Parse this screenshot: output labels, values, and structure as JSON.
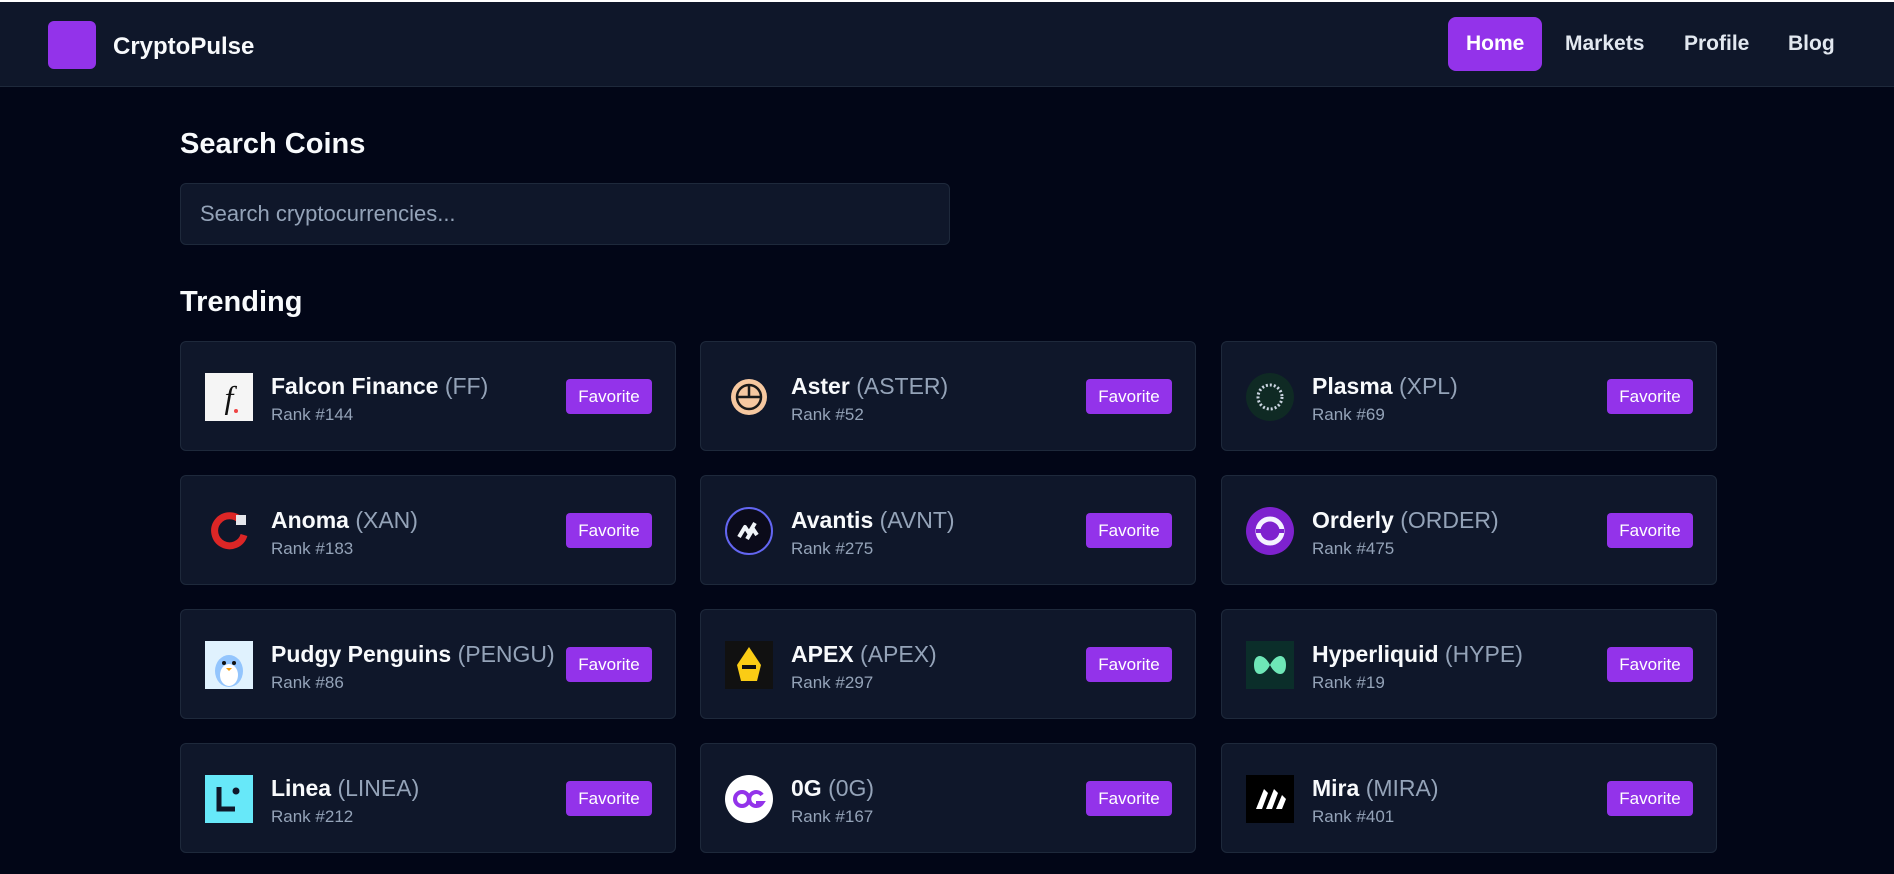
{
  "app": {
    "brand": "CryptoPulse"
  },
  "nav": {
    "items": [
      {
        "label": "Home",
        "active": true
      },
      {
        "label": "Markets",
        "active": false
      },
      {
        "label": "Profile",
        "active": false
      },
      {
        "label": "Blog",
        "active": false
      }
    ]
  },
  "search": {
    "title": "Search Coins",
    "placeholder": "Search cryptocurrencies..."
  },
  "trending": {
    "title": "Trending",
    "favorite_label": "Favorite",
    "coins": [
      {
        "name": "Falcon Finance",
        "symbol": "(FF)",
        "rank": "Rank #144",
        "icon": "falcon-finance-icon"
      },
      {
        "name": "Aster",
        "symbol": "(ASTER)",
        "rank": "Rank #52",
        "icon": "aster-icon"
      },
      {
        "name": "Plasma",
        "symbol": "(XPL)",
        "rank": "Rank #69",
        "icon": "plasma-icon"
      },
      {
        "name": "Anoma",
        "symbol": "(XAN)",
        "rank": "Rank #183",
        "icon": "anoma-icon"
      },
      {
        "name": "Avantis",
        "symbol": "(AVNT)",
        "rank": "Rank #275",
        "icon": "avantis-icon"
      },
      {
        "name": "Orderly",
        "symbol": "(ORDER)",
        "rank": "Rank #475",
        "icon": "orderly-icon"
      },
      {
        "name": "Pudgy Penguins",
        "symbol": "(PENGU)",
        "rank": "Rank #86",
        "icon": "pudgy-penguins-icon"
      },
      {
        "name": "APEX",
        "symbol": "(APEX)",
        "rank": "Rank #297",
        "icon": "apex-icon"
      },
      {
        "name": "Hyperliquid",
        "symbol": "(HYPE)",
        "rank": "Rank #19",
        "icon": "hyperliquid-icon"
      },
      {
        "name": "Linea",
        "symbol": "(LINEA)",
        "rank": "Rank #212",
        "icon": "linea-icon"
      },
      {
        "name": "0G",
        "symbol": "(0G)",
        "rank": "Rank #167",
        "icon": "0g-icon"
      },
      {
        "name": "Mira",
        "symbol": "(MIRA)",
        "rank": "Rank #401",
        "icon": "mira-icon"
      }
    ]
  },
  "colors": {
    "accent": "#9333ea",
    "background": "#020617",
    "surface": "#0f172a",
    "border": "#1e293b",
    "muted": "#94a3b8"
  }
}
